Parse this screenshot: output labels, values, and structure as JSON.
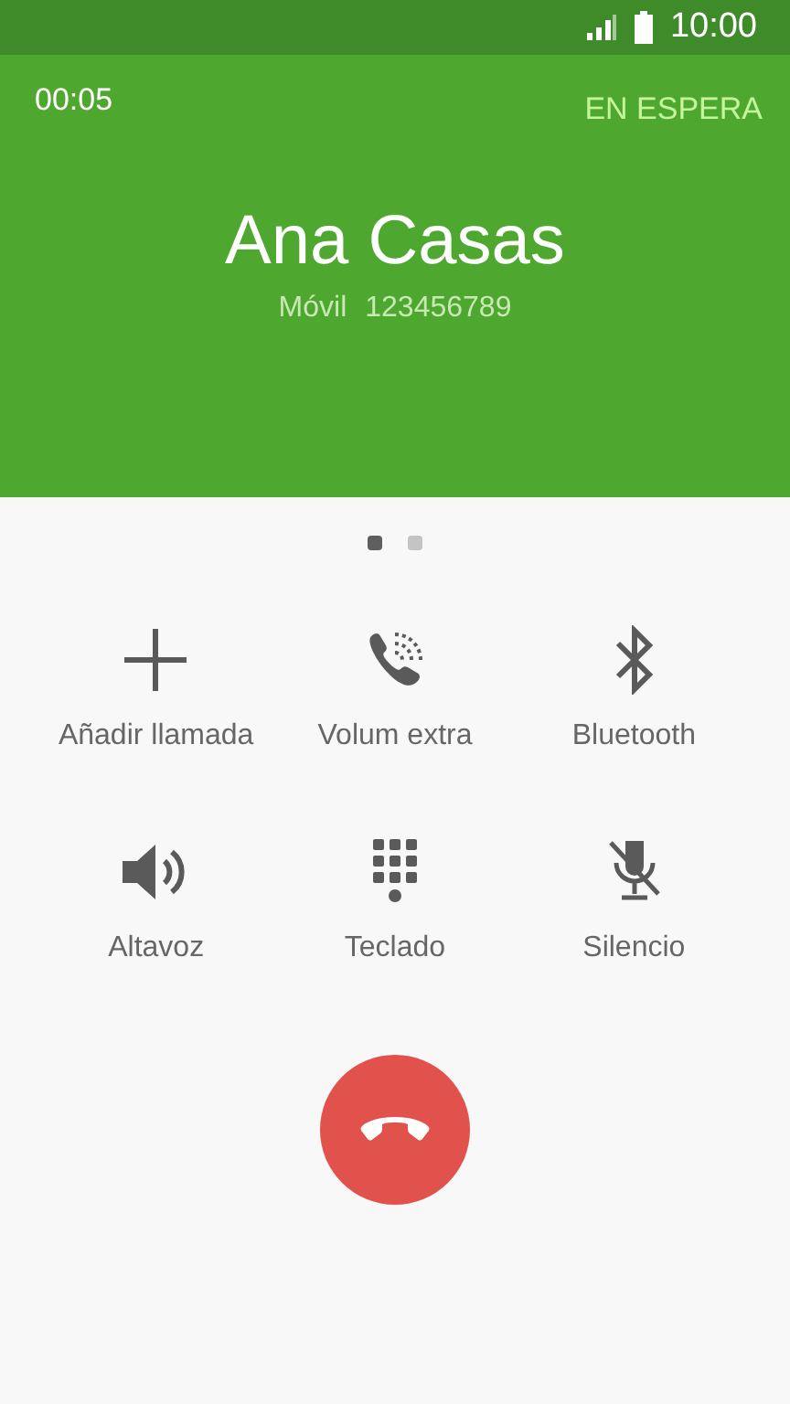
{
  "status_bar": {
    "time": "10:00"
  },
  "call": {
    "duration": "00:05",
    "hold_label": "EN ESPERA",
    "contact_name": "Ana Casas",
    "number_type": "Móvil",
    "number": "123456789"
  },
  "pages": [
    {
      "selected": true
    },
    {
      "selected": false
    }
  ],
  "actions": [
    {
      "kind": "add",
      "label": "Añadir llamada"
    },
    {
      "kind": "volume",
      "label": "Volum extra"
    },
    {
      "kind": "bluetooth",
      "label": "Bluetooth"
    },
    {
      "kind": "speaker",
      "label": "Altavoz"
    },
    {
      "kind": "keypad",
      "label": "Teclado"
    },
    {
      "kind": "mute",
      "label": "Silencio"
    }
  ]
}
